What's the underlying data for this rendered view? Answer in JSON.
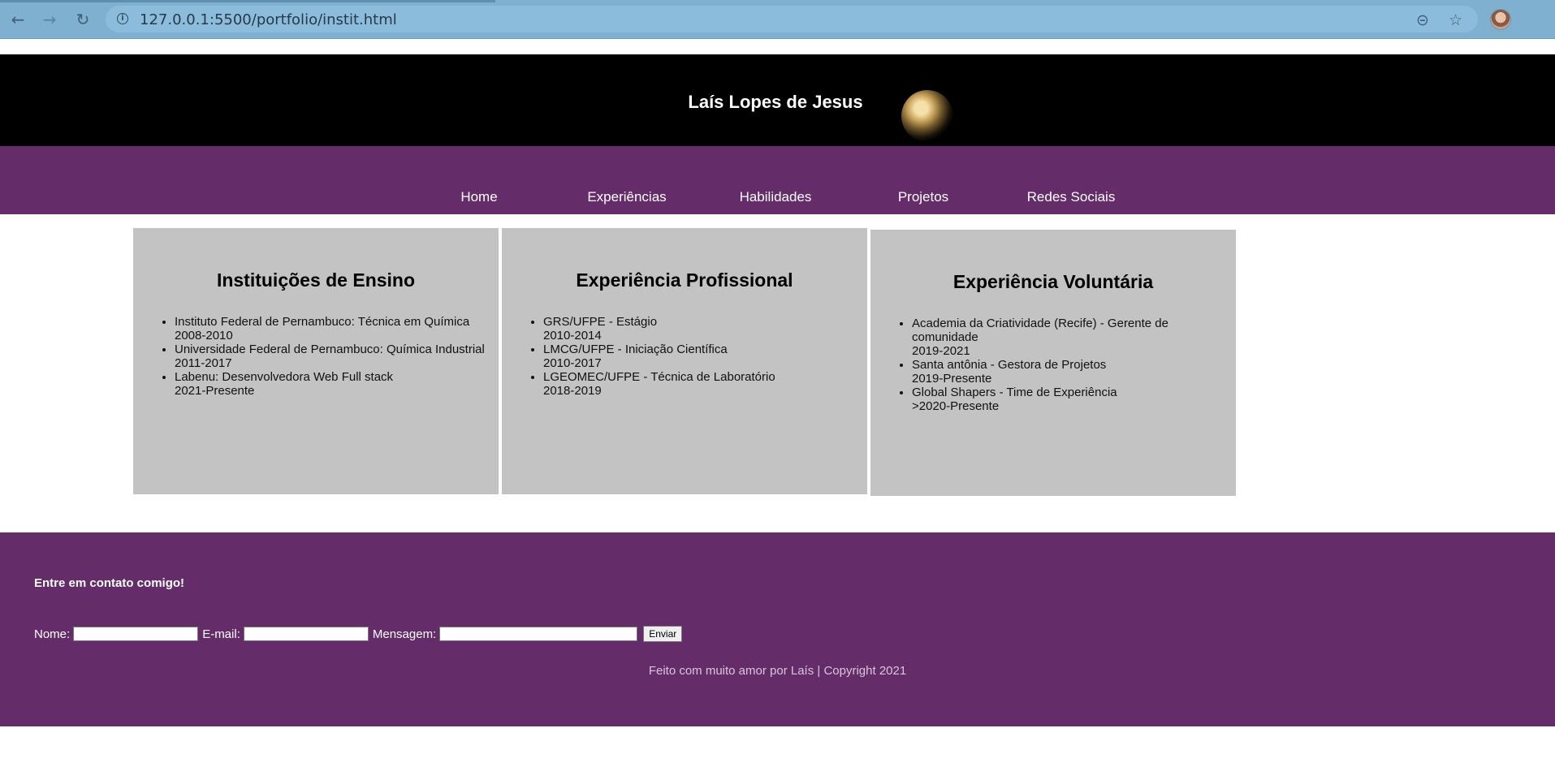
{
  "browser": {
    "back_icon": "arrow-left-icon",
    "forward_icon": "arrow-right-icon",
    "reload_icon": "reload-icon",
    "url": "127.0.0.1:5500/portfolio/instit.html",
    "zoom_icon": "zoom-out-icon",
    "bookmark_icon": "star-icon",
    "accent": "#7fb0d0"
  },
  "header": {
    "title": "Laís Lopes de Jesus",
    "background": "#000000"
  },
  "menu": {
    "background": "#652c6a",
    "items": [
      {
        "label": "Home"
      },
      {
        "label": "Experiências"
      },
      {
        "label": "Habilidades"
      },
      {
        "label": "Projetos"
      },
      {
        "label": "Redes Sociais"
      }
    ]
  },
  "cards": [
    {
      "title": "Instituições de Ensino",
      "items": [
        {
          "line1": "Instituto Federal de Pernambuco: Técnica em Química",
          "line2": "2008-2010"
        },
        {
          "line1": "Universidade Federal de Pernambuco: Química Industrial",
          "line2": "2011-2017"
        },
        {
          "line1": "Labenu: Desenvolvedora Web Full stack",
          "line2": "2021-Presente"
        }
      ]
    },
    {
      "title": "Experiência Profissional",
      "items": [
        {
          "line1": "GRS/UFPE - Estágio",
          "line2": "2010-2014"
        },
        {
          "line1": "LMCG/UFPE - Iniciação Científica",
          "line2": "2010-2017"
        },
        {
          "line1": "LGEOMEC/UFPE - Técnica de Laboratório",
          "line2": "2018-2019"
        }
      ]
    },
    {
      "title": "Experiência Voluntária",
      "items": [
        {
          "line1": "Academia da Criatividade (Recife) - Gerente de comunidade",
          "line2": "2019-2021"
        },
        {
          "line1": "Santa antônia - Gestora de Projetos",
          "line2": "2019-Presente"
        },
        {
          "line1": "Global Shapers - Time de Experiência",
          "line2": ">2020-Presente"
        }
      ]
    }
  ],
  "footer": {
    "contact_title": "Entre em contato comigo!",
    "name_label": "Nome:",
    "name_value": "",
    "email_label": "E-mail:",
    "email_value": "",
    "message_label": "Mensagem:",
    "message_value": "",
    "submit_label": "Enviar",
    "credit": "Feito com muito amor por Laís | Copyright 2021"
  }
}
